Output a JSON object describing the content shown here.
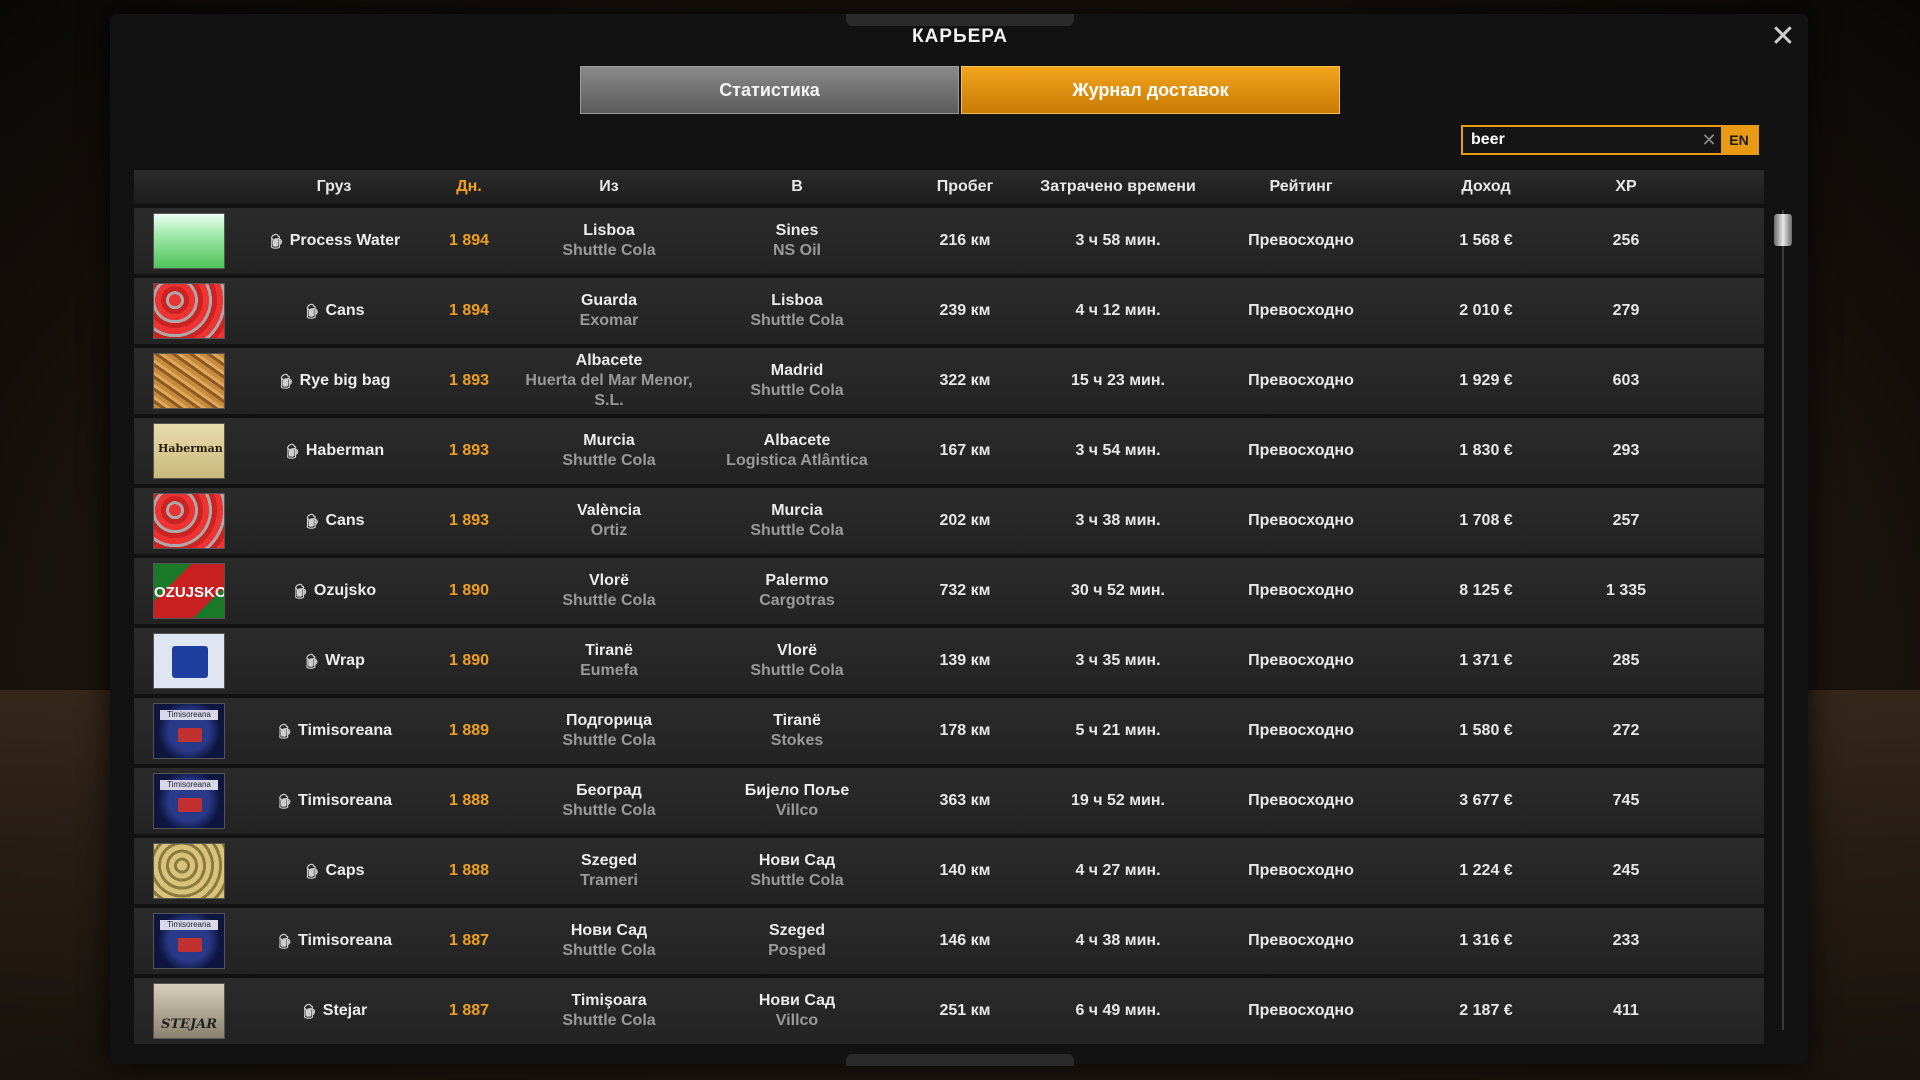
{
  "title": "КАРЬЕРА",
  "close_icon": "close-icon",
  "tabs": [
    {
      "label": "Статистика",
      "active": false
    },
    {
      "label": "Журнал доставок",
      "active": true
    }
  ],
  "search": {
    "value": "beer",
    "lang": "EN"
  },
  "columns": {
    "cargo": "Груз",
    "day": "Дн.",
    "from": "Из",
    "to": "В",
    "distance": "Пробег",
    "time": "Затрачено времени",
    "rating": "Рейтинг",
    "income": "Доход",
    "xp": "XP"
  },
  "accent_color": "#f0a020",
  "rows": [
    {
      "thumb": "water",
      "cargo": "Process Water",
      "day": "1 894",
      "from_city": "Lisboa",
      "from_comp": "Shuttle Cola",
      "to_city": "Sines",
      "to_comp": "NS Oil",
      "distance": "216 км",
      "time": "3 ч 58 мин.",
      "rating": "Превосходно",
      "income": "1 568 €",
      "xp": "256"
    },
    {
      "thumb": "cans",
      "cargo": "Cans",
      "day": "1 894",
      "from_city": "Guarda",
      "from_comp": "Exomar",
      "to_city": "Lisboa",
      "to_comp": "Shuttle Cola",
      "distance": "239 км",
      "time": "4 ч 12 мин.",
      "rating": "Превосходно",
      "income": "2 010 €",
      "xp": "279"
    },
    {
      "thumb": "rye",
      "cargo": "Rye big bag",
      "day": "1 893",
      "from_city": "Albacete",
      "from_comp": "Huerta del Mar Menor, S.L.",
      "to_city": "Madrid",
      "to_comp": "Shuttle Cola",
      "distance": "322 км",
      "time": "15 ч 23 мин.",
      "rating": "Превосходно",
      "income": "1 929 €",
      "xp": "603"
    },
    {
      "thumb": "haberman",
      "cargo": "Haberman",
      "day": "1 893",
      "from_city": "Murcia",
      "from_comp": "Shuttle Cola",
      "to_city": "Albacete",
      "to_comp": "Logistica Atlântica",
      "distance": "167 км",
      "time": "3 ч 54 мин.",
      "rating": "Превосходно",
      "income": "1 830 €",
      "xp": "293"
    },
    {
      "thumb": "cans",
      "cargo": "Cans",
      "day": "1 893",
      "from_city": "València",
      "from_comp": "Ortiz",
      "to_city": "Murcia",
      "to_comp": "Shuttle Cola",
      "distance": "202 км",
      "time": "3 ч 38 мин.",
      "rating": "Превосходно",
      "income": "1 708 €",
      "xp": "257"
    },
    {
      "thumb": "ozujsko",
      "cargo": "Ozujsko",
      "day": "1 890",
      "from_city": "Vlorë",
      "from_comp": "Shuttle Cola",
      "to_city": "Palermo",
      "to_comp": "Cargotras",
      "distance": "732 км",
      "time": "30 ч 52 мин.",
      "rating": "Превосходно",
      "income": "8 125 €",
      "xp": "1 335"
    },
    {
      "thumb": "wrap",
      "cargo": "Wrap",
      "day": "1 890",
      "from_city": "Tiranë",
      "from_comp": "Eumefa",
      "to_city": "Vlorë",
      "to_comp": "Shuttle Cola",
      "distance": "139 км",
      "time": "3 ч 35 мин.",
      "rating": "Превосходно",
      "income": "1 371 €",
      "xp": "285"
    },
    {
      "thumb": "timis",
      "cargo": "Timisoreana",
      "day": "1 889",
      "from_city": "Подгорица",
      "from_comp": "Shuttle Cola",
      "to_city": "Tiranë",
      "to_comp": "Stokes",
      "distance": "178 км",
      "time": "5 ч 21 мин.",
      "rating": "Превосходно",
      "income": "1 580 €",
      "xp": "272"
    },
    {
      "thumb": "timis",
      "cargo": "Timisoreana",
      "day": "1 888",
      "from_city": "Београд",
      "from_comp": "Shuttle Cola",
      "to_city": "Бијело Поље",
      "to_comp": "Villco",
      "distance": "363 км",
      "time": "19 ч 52 мин.",
      "rating": "Превосходно",
      "income": "3 677 €",
      "xp": "745"
    },
    {
      "thumb": "caps",
      "cargo": "Caps",
      "day": "1 888",
      "from_city": "Szeged",
      "from_comp": "Trameri",
      "to_city": "Нови Сад",
      "to_comp": "Shuttle Cola",
      "distance": "140 км",
      "time": "4 ч 27 мин.",
      "rating": "Превосходно",
      "income": "1 224 €",
      "xp": "245"
    },
    {
      "thumb": "timis",
      "cargo": "Timisoreana",
      "day": "1 887",
      "from_city": "Нови Сад",
      "from_comp": "Shuttle Cola",
      "to_city": "Szeged",
      "to_comp": "Posped",
      "distance": "146 км",
      "time": "4 ч 38 мин.",
      "rating": "Превосходно",
      "income": "1 316 €",
      "xp": "233"
    },
    {
      "thumb": "stejar",
      "cargo": "Stejar",
      "day": "1 887",
      "from_city": "Timişoara",
      "from_comp": "Shuttle Cola",
      "to_city": "Нови Сад",
      "to_comp": "Villco",
      "distance": "251 км",
      "time": "6 ч 49 мин.",
      "rating": "Превосходно",
      "income": "2 187 €",
      "xp": "411"
    }
  ]
}
